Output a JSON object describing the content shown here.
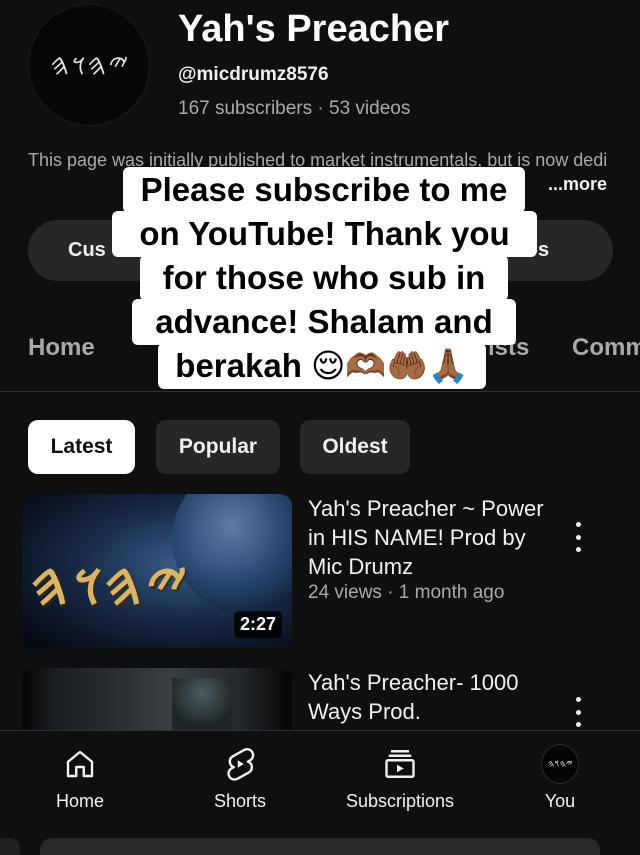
{
  "channel": {
    "avatar_text": "𐤉𐤄𐤅𐤄",
    "name": "Yah's Preacher",
    "handle": "@micdrumz8576",
    "stats": "167 subscribers · 53 videos",
    "description": "This page was initially published to market instrumentals, but is now dedi",
    "more_label": "...more"
  },
  "buttons": {
    "customize_label": "Cus",
    "manage_label": "s"
  },
  "tabs": [
    {
      "label": "Home"
    },
    {
      "label": "ists"
    },
    {
      "label": "Comm"
    }
  ],
  "overlay_caption": {
    "line1": "Please subscribe to me",
    "line2": "on YouTube! Thank you",
    "line3": "for those who sub in",
    "line4": "advance! Shalam and",
    "line5": "berakah 😌🫶🏾🤲🏾🙏🏾"
  },
  "filters": [
    {
      "label": "Latest",
      "selected": true
    },
    {
      "label": "Popular",
      "selected": false
    },
    {
      "label": "Oldest",
      "selected": false
    }
  ],
  "videos": [
    {
      "title": "Yah's Preacher ~ Power in HIS NAME! Prod by Mic Drumz",
      "meta": "24 views · 1 month ago",
      "duration": "2:27",
      "thumb_text": "𐤉𐤄𐤅𐤄"
    },
    {
      "title": "Yah's Preacher- 1000 Ways Prod."
    }
  ],
  "bottom_nav": [
    {
      "label": "Home",
      "icon": "home-icon"
    },
    {
      "label": "Shorts",
      "icon": "shorts-icon"
    },
    {
      "label": "Subscriptions",
      "icon": "subscriptions-icon"
    },
    {
      "label": "You",
      "icon": "avatar",
      "avatar_text": "𐤉𐤄𐤅𐤄"
    }
  ],
  "colors": {
    "background": "#0f0f0f",
    "chip_active": "#ffffff",
    "chip": "#272727",
    "secondary_text": "#aaaaaa"
  }
}
